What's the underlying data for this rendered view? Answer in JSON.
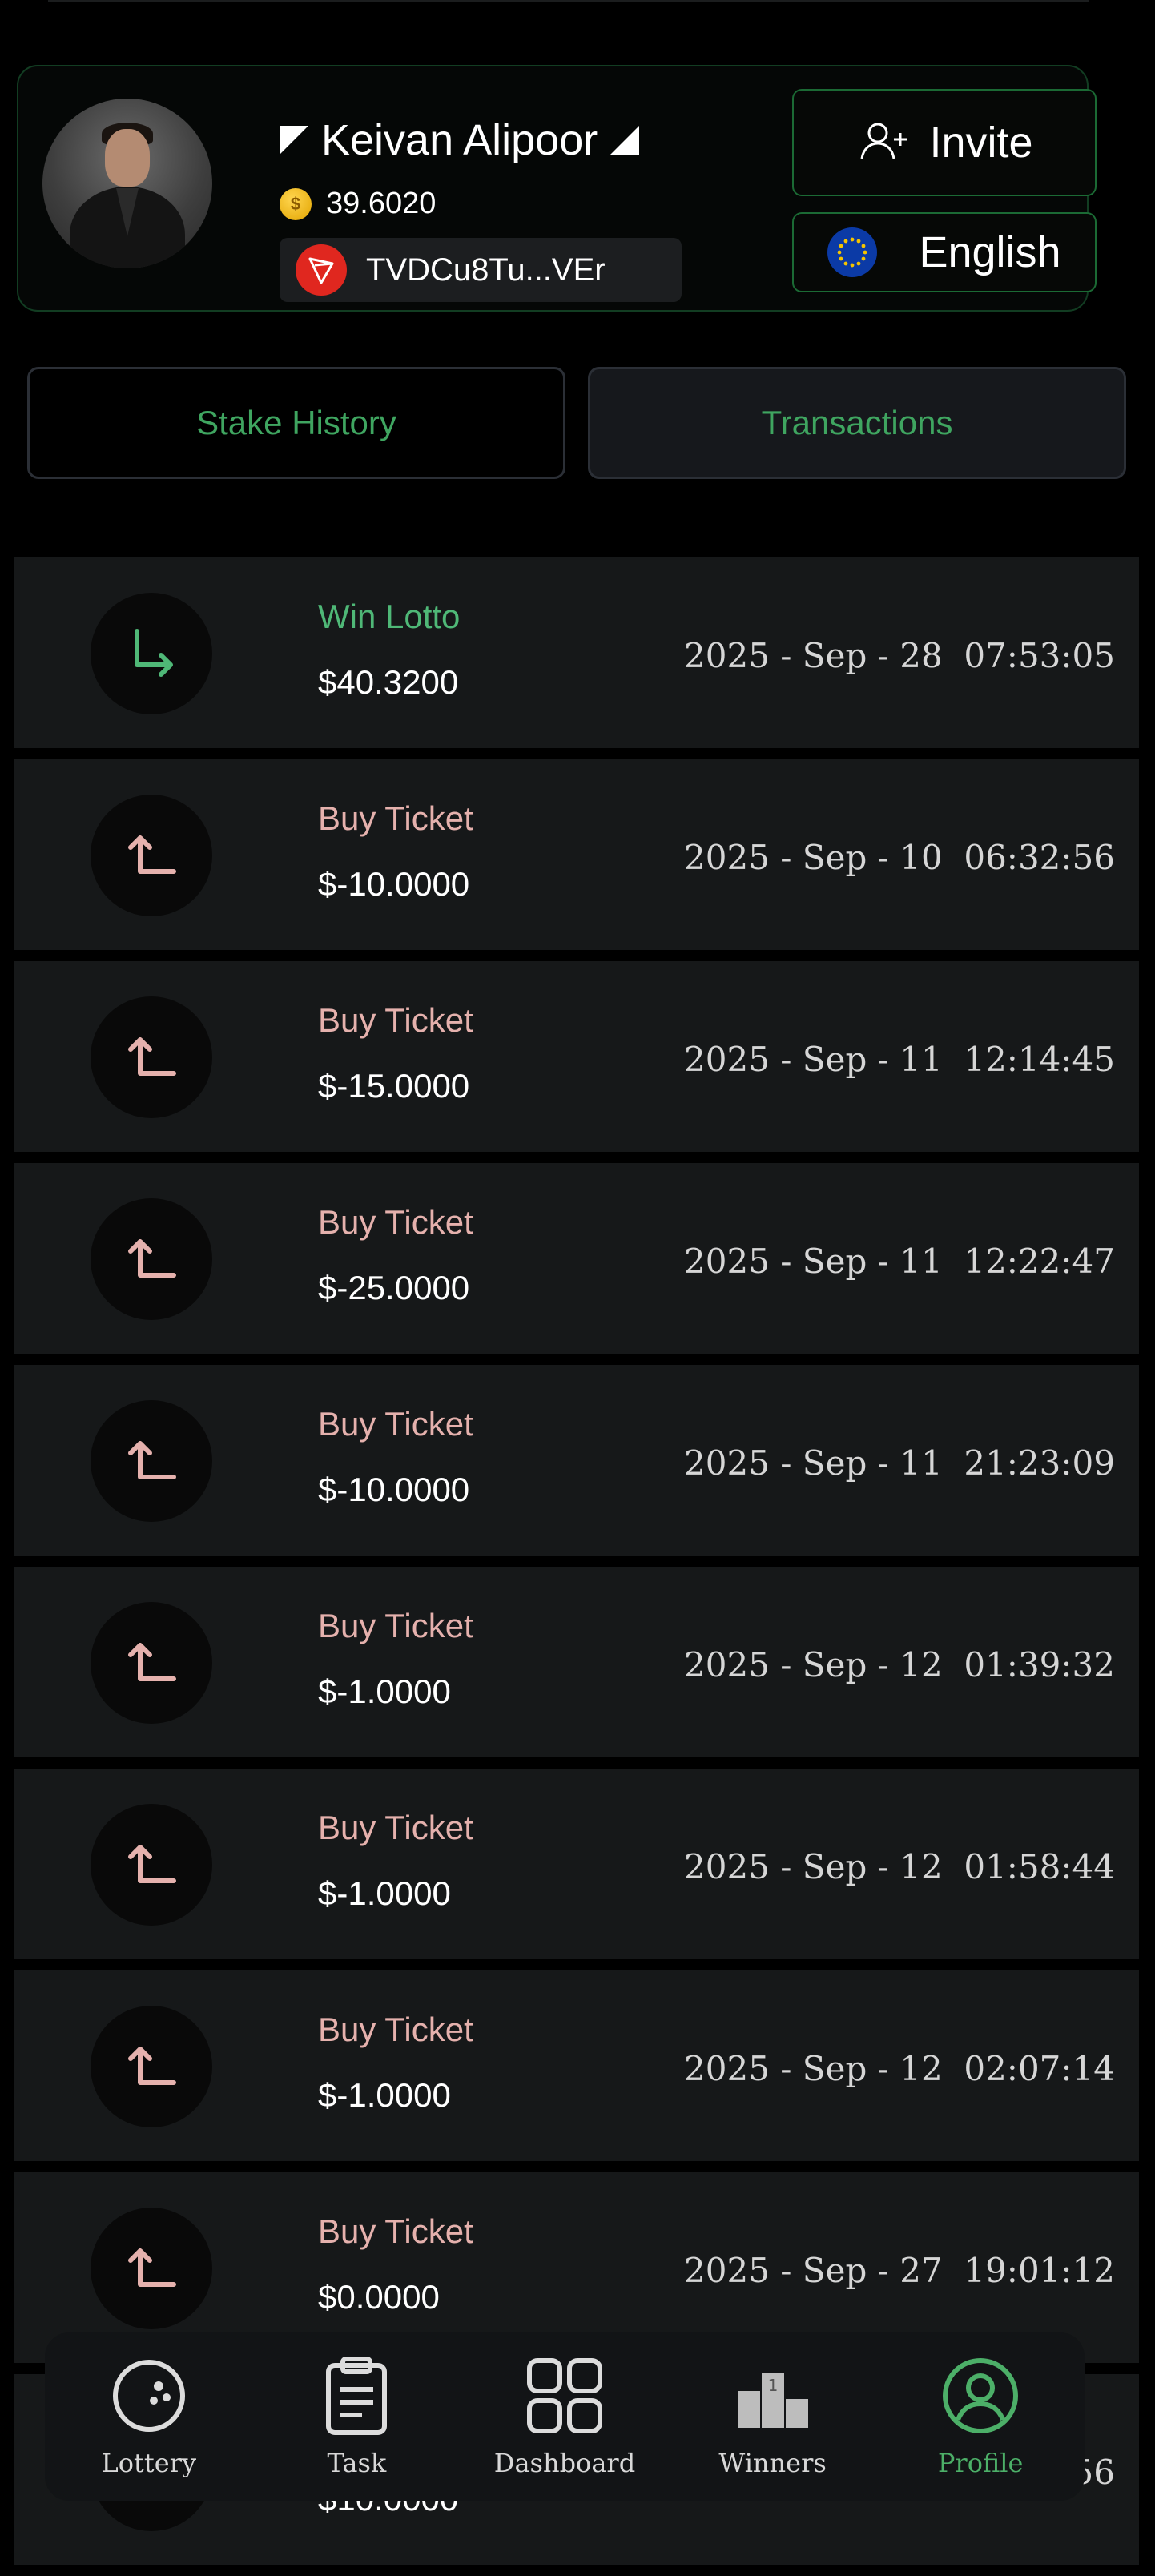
{
  "profile": {
    "name": "Keivan Alipoor",
    "balance": "39.6020",
    "wallet_address": "TVDCu8Tu...VEr",
    "invite_label": "Invite",
    "language_label": "English"
  },
  "tabs": [
    {
      "label": "Stake History",
      "active": false
    },
    {
      "label": "Transactions",
      "active": true
    }
  ],
  "transactions": [
    {
      "type": "Win Lotto",
      "amount": "$40.3200",
      "time": "2025 - Sep - 28  07:53:05",
      "direction": "in",
      "color": "#4fb877"
    },
    {
      "type": "Buy Ticket",
      "amount": "$-10.0000",
      "time": "2025 - Sep - 10  06:32:56",
      "direction": "out",
      "color": "#e5b1ad"
    },
    {
      "type": "Buy Ticket",
      "amount": "$-15.0000",
      "time": "2025 - Sep - 11  12:14:45",
      "direction": "out",
      "color": "#e5b1ad"
    },
    {
      "type": "Buy Ticket",
      "amount": "$-25.0000",
      "time": "2025 - Sep - 11  12:22:47",
      "direction": "out",
      "color": "#e5b1ad"
    },
    {
      "type": "Buy Ticket",
      "amount": "$-10.0000",
      "time": "2025 - Sep - 11  21:23:09",
      "direction": "out",
      "color": "#e5b1ad"
    },
    {
      "type": "Buy Ticket",
      "amount": "$-1.0000",
      "time": "2025 - Sep - 12  01:39:32",
      "direction": "out",
      "color": "#e5b1ad"
    },
    {
      "type": "Buy Ticket",
      "amount": "$-1.0000",
      "time": "2025 - Sep - 12  01:58:44",
      "direction": "out",
      "color": "#e5b1ad"
    },
    {
      "type": "Buy Ticket",
      "amount": "$-1.0000",
      "time": "2025 - Sep - 12  02:07:14",
      "direction": "out",
      "color": "#e5b1ad"
    },
    {
      "type": "Buy Ticket",
      "amount": "$0.0000",
      "time": "2025 - Sep - 27  19:01:12",
      "direction": "out",
      "color": "#e5b1ad"
    },
    {
      "type": "",
      "amount": "$10.0000",
      "time": "56",
      "direction": "out",
      "color": "#e5b1ad"
    }
  ],
  "nav": {
    "lottery": "Lottery",
    "task": "Task",
    "dashboard": "Dashboard",
    "winners": "Winners",
    "profile": "Profile",
    "winners_rank": "1"
  },
  "colors": {
    "accent_green": "#4caf68",
    "win": "#4fb877",
    "loss": "#e5b1ad"
  }
}
